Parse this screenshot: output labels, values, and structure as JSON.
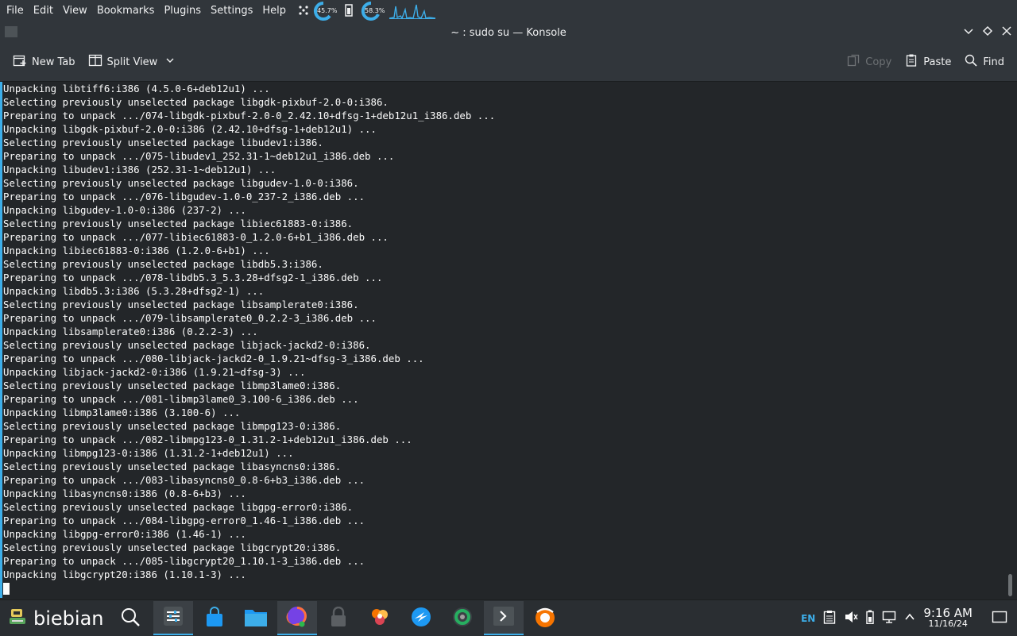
{
  "menubar": {
    "items": [
      "File",
      "Edit",
      "View",
      "Bookmarks",
      "Plugins",
      "Settings",
      "Help"
    ],
    "cpu_percent": "45.7%",
    "mem_percent": "58.3%"
  },
  "window": {
    "title": "~ : sudo su — Konsole"
  },
  "toolbar": {
    "new_tab": "New Tab",
    "split_view": "Split View",
    "copy": "Copy",
    "paste": "Paste",
    "find": "Find"
  },
  "terminal": {
    "lines": [
      "Unpacking libtiff6:i386 (4.5.0-6+deb12u1) ...",
      "Selecting previously unselected package libgdk-pixbuf-2.0-0:i386.",
      "Preparing to unpack .../074-libgdk-pixbuf-2.0-0_2.42.10+dfsg-1+deb12u1_i386.deb ...",
      "Unpacking libgdk-pixbuf-2.0-0:i386 (2.42.10+dfsg-1+deb12u1) ...",
      "Selecting previously unselected package libudev1:i386.",
      "Preparing to unpack .../075-libudev1_252.31-1~deb12u1_i386.deb ...",
      "Unpacking libudev1:i386 (252.31-1~deb12u1) ...",
      "Selecting previously unselected package libgudev-1.0-0:i386.",
      "Preparing to unpack .../076-libgudev-1.0-0_237-2_i386.deb ...",
      "Unpacking libgudev-1.0-0:i386 (237-2) ...",
      "Selecting previously unselected package libiec61883-0:i386.",
      "Preparing to unpack .../077-libiec61883-0_1.2.0-6+b1_i386.deb ...",
      "Unpacking libiec61883-0:i386 (1.2.0-6+b1) ...",
      "Selecting previously unselected package libdb5.3:i386.",
      "Preparing to unpack .../078-libdb5.3_5.3.28+dfsg2-1_i386.deb ...",
      "Unpacking libdb5.3:i386 (5.3.28+dfsg2-1) ...",
      "Selecting previously unselected package libsamplerate0:i386.",
      "Preparing to unpack .../079-libsamplerate0_0.2.2-3_i386.deb ...",
      "Unpacking libsamplerate0:i386 (0.2.2-3) ...",
      "Selecting previously unselected package libjack-jackd2-0:i386.",
      "Preparing to unpack .../080-libjack-jackd2-0_1.9.21~dfsg-3_i386.deb ...",
      "Unpacking libjack-jackd2-0:i386 (1.9.21~dfsg-3) ...",
      "Selecting previously unselected package libmp3lame0:i386.",
      "Preparing to unpack .../081-libmp3lame0_3.100-6_i386.deb ...",
      "Unpacking libmp3lame0:i386 (3.100-6) ...",
      "Selecting previously unselected package libmpg123-0:i386.",
      "Preparing to unpack .../082-libmpg123-0_1.31.2-1+deb12u1_i386.deb ...",
      "Unpacking libmpg123-0:i386 (1.31.2-1+deb12u1) ...",
      "Selecting previously unselected package libasyncns0:i386.",
      "Preparing to unpack .../083-libasyncns0_0.8-6+b3_i386.deb ...",
      "Unpacking libasyncns0:i386 (0.8-6+b3) ...",
      "Selecting previously unselected package libgpg-error0:i386.",
      "Preparing to unpack .../084-libgpg-error0_1.46-1_i386.deb ...",
      "Unpacking libgpg-error0:i386 (1.46-1) ...",
      "Selecting previously unselected package libgcrypt20:i386.",
      "Preparing to unpack .../085-libgcrypt20_1.10.1-3_i386.deb ...",
      "Unpacking libgcrypt20:i386 (1.10.1-3) ..."
    ]
  },
  "taskbar": {
    "launcher_label": "biebian",
    "tasks": [
      "system-settings",
      "store",
      "file-manager",
      "firefox",
      "lock",
      "colors-app",
      "remote-app",
      "disk-app",
      "konsole",
      "ubuntu-app"
    ],
    "language": "EN",
    "time": "9:16 AM",
    "date": "11/16/24"
  },
  "colors": {
    "accent": "#3daee9",
    "background": "#232629",
    "panel": "#31363b"
  }
}
